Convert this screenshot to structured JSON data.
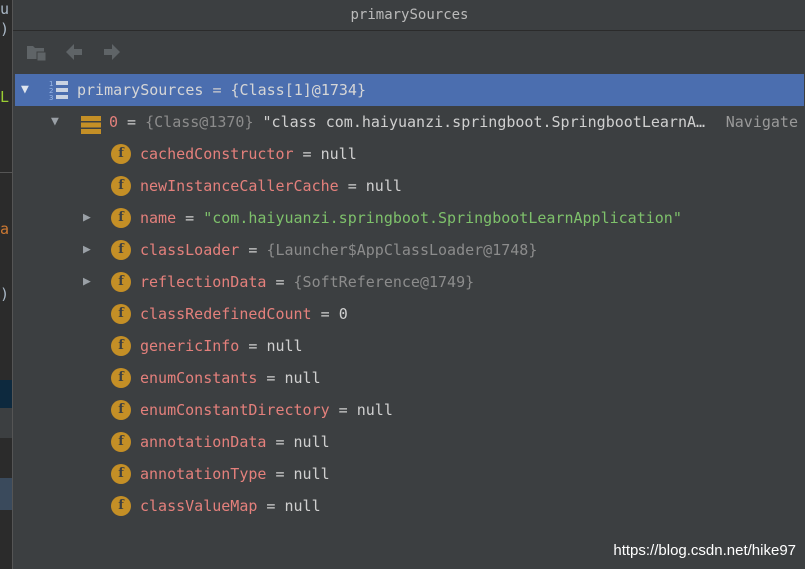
{
  "window": {
    "title": "primarySources"
  },
  "background_editor": {
    "chars": [
      "u",
      ")",
      "L",
      "a",
      ")"
    ]
  },
  "toolbar": {
    "buttons": [
      {
        "icon": "folder-icon"
      },
      {
        "icon": "back-arrow-icon"
      },
      {
        "icon": "forward-arrow-icon"
      }
    ]
  },
  "tree": {
    "root": {
      "name": "primarySources",
      "eq": " = ",
      "value": "{Class[1]@1734}"
    },
    "element": {
      "name": "0",
      "eq": " = ",
      "ref": "{Class@1370}",
      "value": " \"class com.haiyuanzi.springboot.SpringbootLearnA…",
      "navigate": "Navigate"
    },
    "fields": [
      {
        "name": "cachedConstructor",
        "eq": " = ",
        "value": "null",
        "kind": "val",
        "expandable": false
      },
      {
        "name": "newInstanceCallerCache",
        "eq": " = ",
        "value": "null",
        "kind": "val",
        "expandable": false
      },
      {
        "name": "name",
        "eq": " = ",
        "value": "\"com.haiyuanzi.springboot.SpringbootLearnApplication\"",
        "kind": "str",
        "expandable": true
      },
      {
        "name": "classLoader",
        "eq": " = ",
        "value": "{Launcher$AppClassLoader@1748}",
        "kind": "ref",
        "expandable": true
      },
      {
        "name": "reflectionData",
        "eq": " = ",
        "value": "{SoftReference@1749}",
        "kind": "ref",
        "expandable": true
      },
      {
        "name": "classRedefinedCount",
        "eq": " = ",
        "value": "0",
        "kind": "val",
        "expandable": false
      },
      {
        "name": "genericInfo",
        "eq": " = ",
        "value": "null",
        "kind": "val",
        "expandable": false
      },
      {
        "name": "enumConstants",
        "eq": " = ",
        "value": "null",
        "kind": "val",
        "expandable": false
      },
      {
        "name": "enumConstantDirectory",
        "eq": " = ",
        "value": "null",
        "kind": "val",
        "expandable": false
      },
      {
        "name": "annotationData",
        "eq": " = ",
        "value": "null",
        "kind": "val",
        "expandable": false
      },
      {
        "name": "annotationType",
        "eq": " = ",
        "value": "null",
        "kind": "val",
        "expandable": false
      },
      {
        "name": "classValueMap",
        "eq": " = ",
        "value": "null",
        "kind": "val",
        "expandable": false
      }
    ],
    "field_icon_letter": "f"
  },
  "watermark": "https://blog.csdn.net/hike97",
  "colors": {
    "selection": "#4b6eaf",
    "field_icon": "#c48f26",
    "field_name": "#e4807c",
    "string_value": "#7ec16b"
  }
}
